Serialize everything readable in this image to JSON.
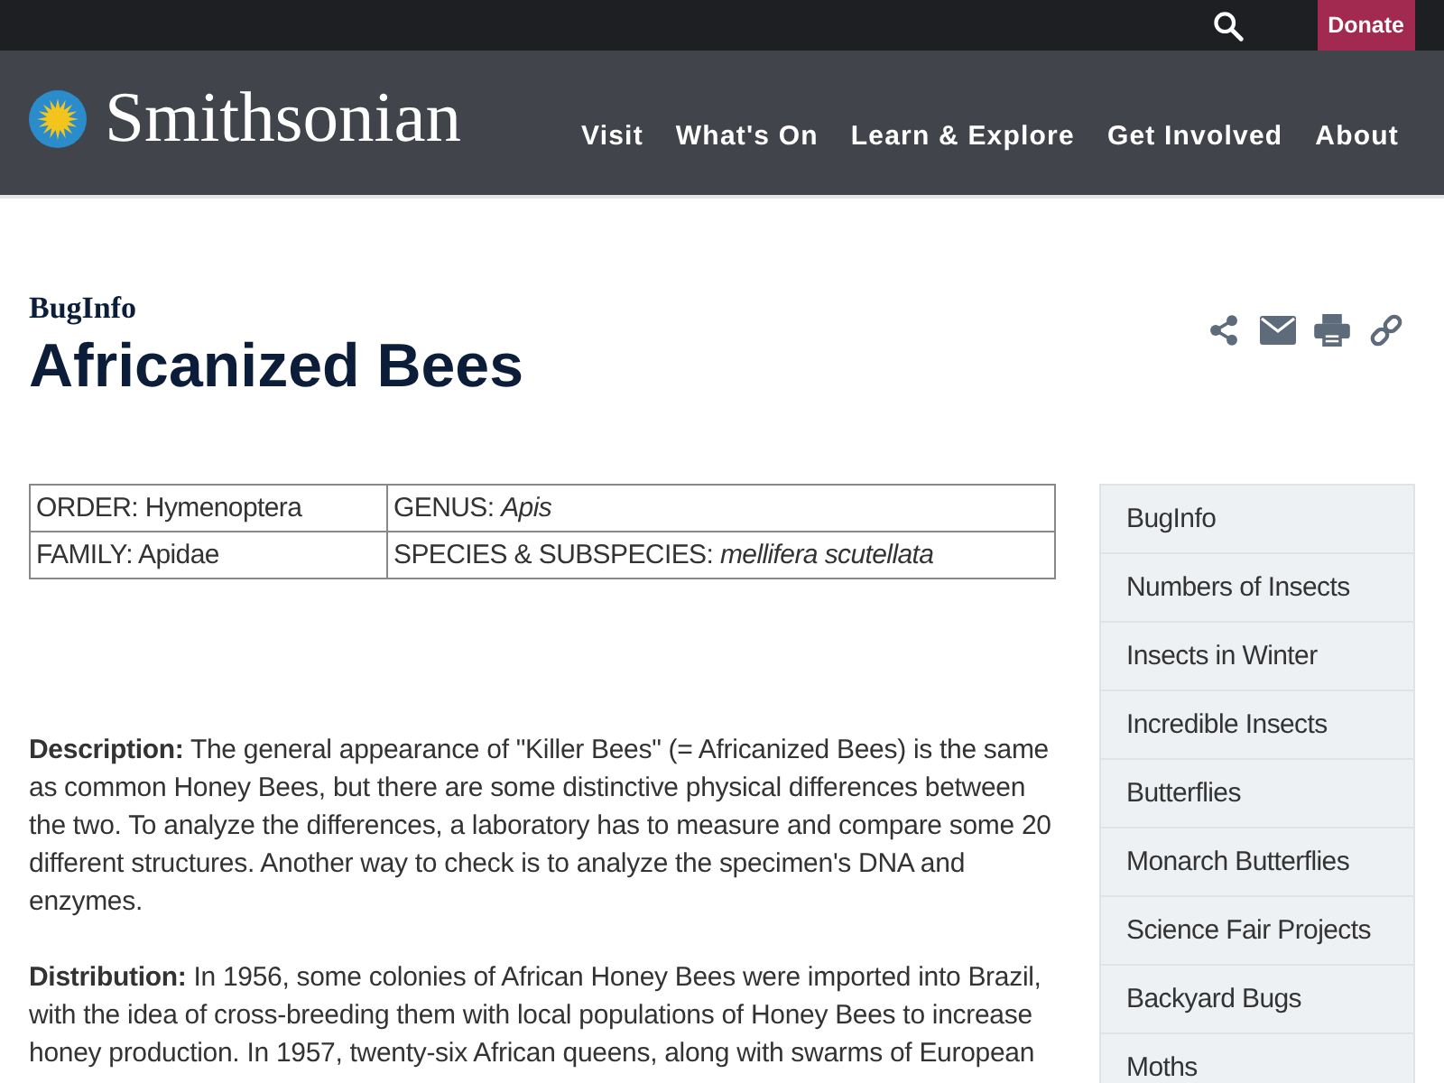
{
  "top_bar": {
    "donate": "Donate"
  },
  "header": {
    "logo_text": "Smithsonian",
    "nav": [
      "Visit",
      "What's On",
      "Learn & Explore",
      "Get Involved",
      "About"
    ]
  },
  "page": {
    "section": "BugInfo",
    "title": "Africanized Bees"
  },
  "taxonomy": {
    "rows": [
      [
        "ORDER: Hymenoptera",
        "GENUS: *Apis*"
      ],
      [
        "FAMILY: Apidae",
        "SPECIES & SUBSPECIES: *mellifera scutellata*"
      ]
    ]
  },
  "paragraphs": [
    "**Description:** The general appearance of \"Killer Bees\" (= Africanized Bees) is the same as common Honey Bees, but there are some distinctive physical differences between the two. To analyze the differences, a laboratory has to measure and compare some 20 different structures. Another way to check is to analyze the specimen's DNA and enzymes.",
    "**Distribution:** In 1956, some colonies of African Honey Bees were imported into Brazil, with the idea of cross-breeding them with local populations of Honey Bees to increase honey production. In 1957, twenty-six African queens, along with swarms of European"
  ],
  "sidebar": {
    "items": [
      "BugInfo",
      "Numbers of Insects",
      "Insects in Winter",
      "Incredible Insects",
      "Butterflies",
      "Monarch Butterflies",
      "Science Fair Projects",
      "Backyard Bugs",
      "Moths"
    ]
  }
}
